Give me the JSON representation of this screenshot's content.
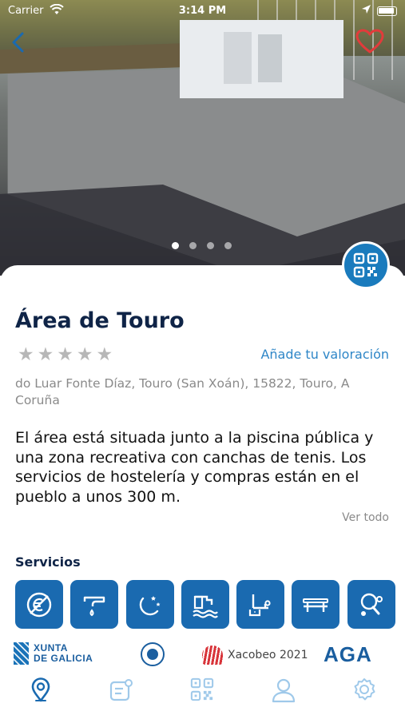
{
  "status_bar": {
    "carrier": "Carrier",
    "time": "3:14 PM"
  },
  "place": {
    "title": "Área de Touro",
    "rating_stars": 5,
    "rate_link": "Añade tu valoración",
    "address": "do Luar Fonte Díaz, Touro (San Xoán), 15822, Touro, A Coruña",
    "description": "El área está situada junto a la piscina pública y una zona recreativa con canchas de tenis. Los servicios de hostelería y compras están en el pueblo a unos 300 m.",
    "see_all": "Ver todo"
  },
  "gallery": {
    "pages": 4,
    "active_page": 1
  },
  "services": {
    "title": "Servicios",
    "items": [
      {
        "icon": "no-cost-icon"
      },
      {
        "icon": "water-tap-icon"
      },
      {
        "icon": "overnight-stay-icon"
      },
      {
        "icon": "waste-disposal-icon"
      },
      {
        "icon": "sink-icon"
      },
      {
        "icon": "picnic-table-icon"
      },
      {
        "icon": "table-tennis-icon"
      }
    ]
  },
  "logos": {
    "xunta_line1": "XUNTA",
    "xunta_line2": "DE GALICIA",
    "xacobeo": "Xacobeo 2021",
    "aga": "AGA"
  },
  "tabbar": {
    "items": [
      {
        "icon": "map-pin-icon",
        "active": true
      },
      {
        "icon": "news-icon",
        "active": false
      },
      {
        "icon": "qr-code-icon",
        "active": false
      },
      {
        "icon": "user-icon",
        "active": false
      },
      {
        "icon": "settings-icon",
        "active": false
      }
    ]
  },
  "colors": {
    "primary": "#1a6ab0",
    "link": "#2e86c7",
    "heart": "#e23b3b",
    "title": "#0f2447"
  }
}
